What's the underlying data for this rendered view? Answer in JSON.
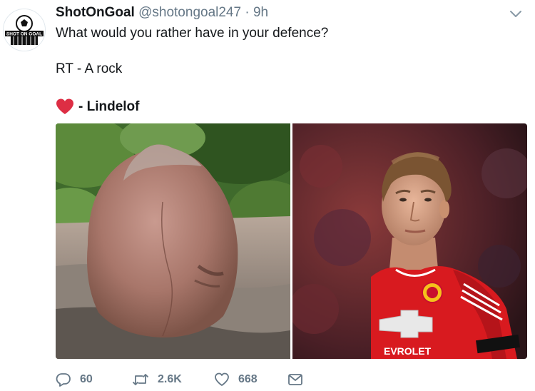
{
  "tweet": {
    "display_name": "ShotOnGoal",
    "handle": "@shotongoal247",
    "separator": "·",
    "time": "9h",
    "avatar_text": "SHOT ON GOAL",
    "text_line1": "What would you rather have in your defence?",
    "text_line2": "RT - A rock",
    "text_line3": "- Lindelof",
    "jersey_sponsor": "EVROLET"
  },
  "actions": {
    "replies": "60",
    "retweets": "2.6K",
    "likes": "668"
  },
  "icons": {
    "chevron": "chevron-down-icon",
    "reply": "reply-icon",
    "retweet": "retweet-icon",
    "like": "heart-icon",
    "dm": "envelope-icon",
    "emoji": "red-heart-emoji"
  },
  "colors": {
    "text": "#14171a",
    "muted": "#657786",
    "emoji_red": "#e0245e"
  }
}
